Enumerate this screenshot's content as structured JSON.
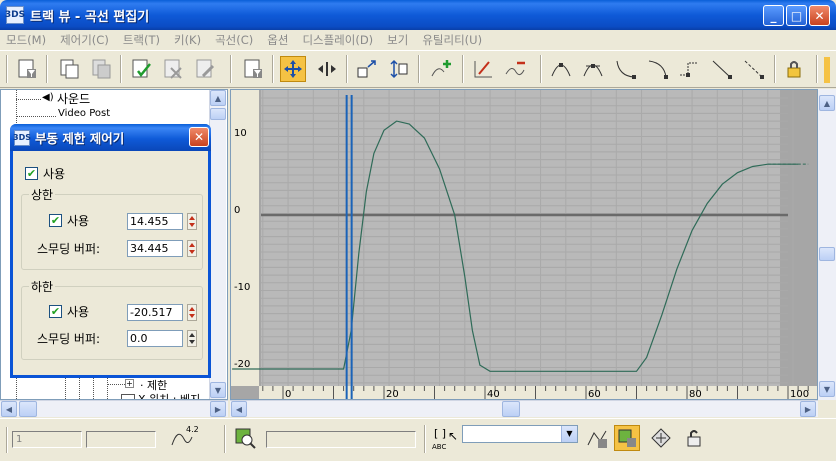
{
  "window": {
    "title": "트랙 뷰 - 곡선 편집기",
    "icon_text": "3DS"
  },
  "menu": [
    "모드(M)",
    "제어기(C)",
    "트랙(T)",
    "키(K)",
    "곡선(C)",
    "옵션",
    "디스플레이(D)",
    "보기",
    "유틸리티(U)"
  ],
  "tree": {
    "items": [
      "사운드",
      "Video Post",
      "제한",
      "X 위치 : 베지"
    ]
  },
  "dialog": {
    "title": "부동 제한 제어기",
    "enable_label": "사용",
    "upper": {
      "label": "상한",
      "enable_label": "사용",
      "value": "14.455",
      "smooth_label": "스무딩 버퍼:",
      "smooth_value": "34.445"
    },
    "lower": {
      "label": "하한",
      "enable_label": "사용",
      "value": "-20.517",
      "smooth_label": "스무딩 버퍼:",
      "smooth_value": "0.0"
    }
  },
  "curve": {
    "y_ticks": [
      "10",
      "0",
      "-10",
      "-20"
    ],
    "x_ticks": [
      "0",
      "20",
      "40",
      "60",
      "80",
      "100"
    ],
    "curve_color": "#2f6b58",
    "time_slider_color": "#1a63b8"
  },
  "status": {
    "frame_field": "1",
    "abc_label": "ABC",
    "curve_icon_label": "4.2"
  }
}
